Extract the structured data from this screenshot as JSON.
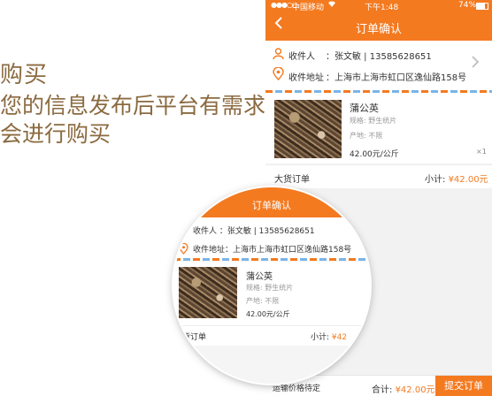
{
  "promo": {
    "title": "购买",
    "description": "您的信息发布后平台有需求会进行购买"
  },
  "status_bar": {
    "signal": "●●●○○",
    "carrier": "中国移动",
    "time": "下午1:48",
    "battery": "74%"
  },
  "nav": {
    "back_icon": "back-chevron",
    "title": "订单确认"
  },
  "address": {
    "recipient_label": "收件人",
    "recipient_value": "：张文敏 | 13585628651",
    "address_label": "收件地址",
    "address_value": "：上海市上海市虹口区逸仙路158号"
  },
  "product": {
    "name": "蒲公英",
    "spec1": "规格: 野生统片",
    "spec2": "产地: 不限",
    "price": "42.00元/公斤",
    "quantity": "×1"
  },
  "subtotal": {
    "label": "大货订单",
    "amount_label": "小计: ",
    "amount": "¥42.00元"
  },
  "bottom": {
    "shipping": "运输价格待定",
    "total_label": "合计: ",
    "total": "¥42.00元",
    "submit": "提交订单"
  },
  "magnifier": {
    "title": "订单确认",
    "recipient": "收件人  ：张文敏 | 13585628651",
    "address": "收件地址：上海市上海市虹口区逸仙路158号",
    "product_name": "蒲公英",
    "spec1": "规格: 野生统片",
    "spec2": "产地: 不限",
    "price": "42.00元/公斤",
    "sub_label": "货订单",
    "sub_amount_label": "小计: ",
    "sub_amount": "¥42"
  },
  "colors": {
    "accent": "#f47a20",
    "promo_text": "#8b6a40"
  }
}
